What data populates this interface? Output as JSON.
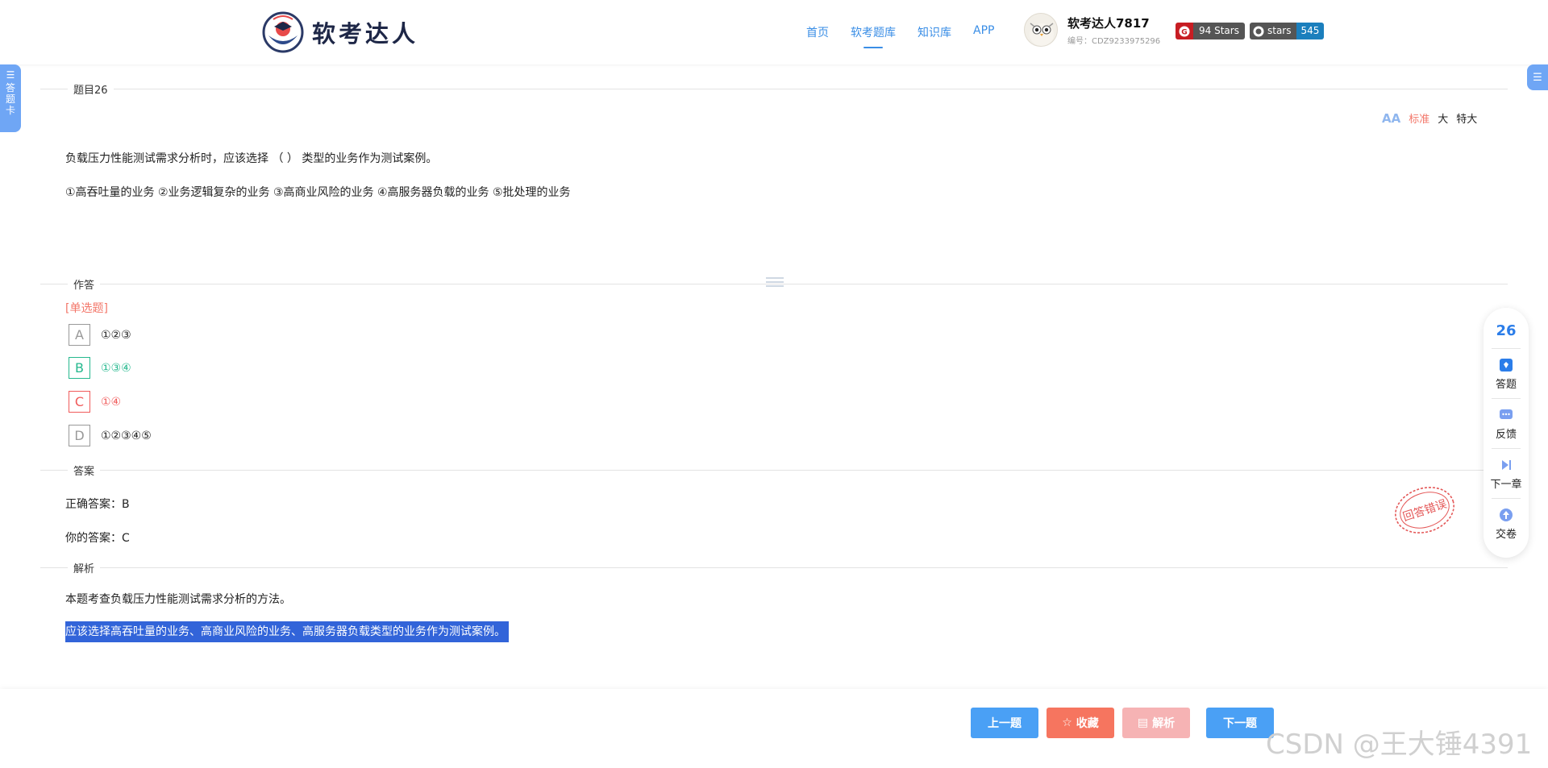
{
  "header": {
    "logo_text": "软考达人",
    "nav": [
      "首页",
      "软考题库",
      "知识库",
      "APP"
    ],
    "nav_active": 1,
    "user_name": "软考达人7817",
    "user_id": "编号：CDZ9233975296",
    "gitee_badge": "94 Stars",
    "github_badge_label": "stars",
    "github_badge_count": "545"
  },
  "side": {
    "left_tab": "答题卡"
  },
  "question": {
    "section_title": "题目26",
    "font_sizes": [
      "标准",
      "大",
      "特大"
    ],
    "font_selected": 0,
    "stem": "负载压力性能测试需求分析时，应该选择 （ ） 类型的业务作为测试案例。",
    "items": "①高吞吐量的业务 ②业务逻辑复杂的业务 ③高商业风险的业务 ④高服务器负载的业务 ⑤批处理的业务"
  },
  "answer_area": {
    "section_title": "作答",
    "type": "[单选题]",
    "options": [
      {
        "key": "A",
        "text": "①②③",
        "state": "normal"
      },
      {
        "key": "B",
        "text": "①③④",
        "state": "correct"
      },
      {
        "key": "C",
        "text": "①④",
        "state": "wrong"
      },
      {
        "key": "D",
        "text": "①②③④⑤",
        "state": "normal"
      }
    ]
  },
  "result": {
    "section_title": "答案",
    "correct": "正确答案：B",
    "yours": "你的答案：C",
    "stamp": "回答错误"
  },
  "analysis": {
    "section_title": "解析",
    "line1": "本题考查负载压力性能测试需求分析的方法。",
    "line2": "应该选择高吞吐量的业务、高商业风险的业务、高服务器负载类型的业务作为测试案例。"
  },
  "float_panel": {
    "number": "26",
    "items": [
      "答题",
      "反馈",
      "下一章",
      "交卷"
    ]
  },
  "bottom": {
    "prev": "上一题",
    "favorite": "收藏",
    "analysis": "解析",
    "next": "下一题",
    "watermark": "CSDN @王大锤4391"
  },
  "colors": {
    "primary": "#4aa0f5",
    "correct": "#25b88e",
    "wrong": "#f05b5b",
    "favorite": "#f6755f",
    "highlight": "#3264d9"
  }
}
